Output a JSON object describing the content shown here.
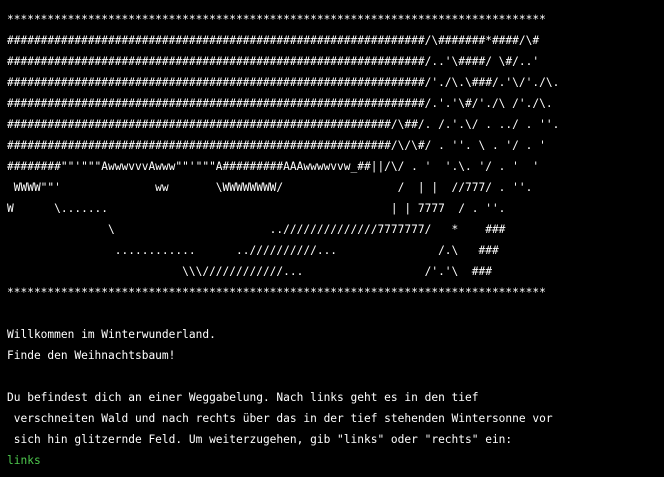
{
  "terminal": {
    "background": "#000000",
    "text_color": "#ffffff",
    "input_color": "#4ec94e",
    "art": [
      "********************************************************************************",
      "##############################################################/\\#######*####/\\#",
      "##############################################################/..'\\####/ \\#/..'",
      "##############################################################/'./\\.\\###/.'\\/'./\\.",
      "##############################################################/.'.'\\#/'./\\ /'./\\.",
      "#########################################################/\\##/. /.'.\\/ . ../ . ''.",
      "#########################################################/\\/\\#/ . ''. \\ . '/ . '",
      "########\"\"'\"\"\"AwwwvvvAwww\"\"'\"\"\"A#########AAAwwwwvvw_##||/\\/ . '  '.\\. '/ . '  '",
      " WWWW\"\"'              ww       \\WWWWWWWW/                 /  | |  //777/ . ''.",
      "W      \\.......                                          | | 7777  / . ''.",
      "               \\                       ..//////////////7777777/   *    ###",
      "                ............      ..//////////...               /.\\   ###",
      "                          \\\\\\////////////...                  /'.'\\  ###",
      "********************************************************************************"
    ],
    "welcome_line_1": "Willkommen im Winterwunderland.",
    "welcome_line_2": "Finde den Weihnachtsbaum!",
    "prompt_line_1": "Du befindest dich an einer Weggabelung. Nach links geht es in den tief",
    "prompt_line_2": " verschneiten Wald und nach rechts über das in der tief stehenden Wintersonne vor",
    "prompt_line_3": " sich hin glitzernde Feld. Um weiterzugehen, gib \"links\" oder \"rechts\" ein:",
    "user_input": "links"
  }
}
